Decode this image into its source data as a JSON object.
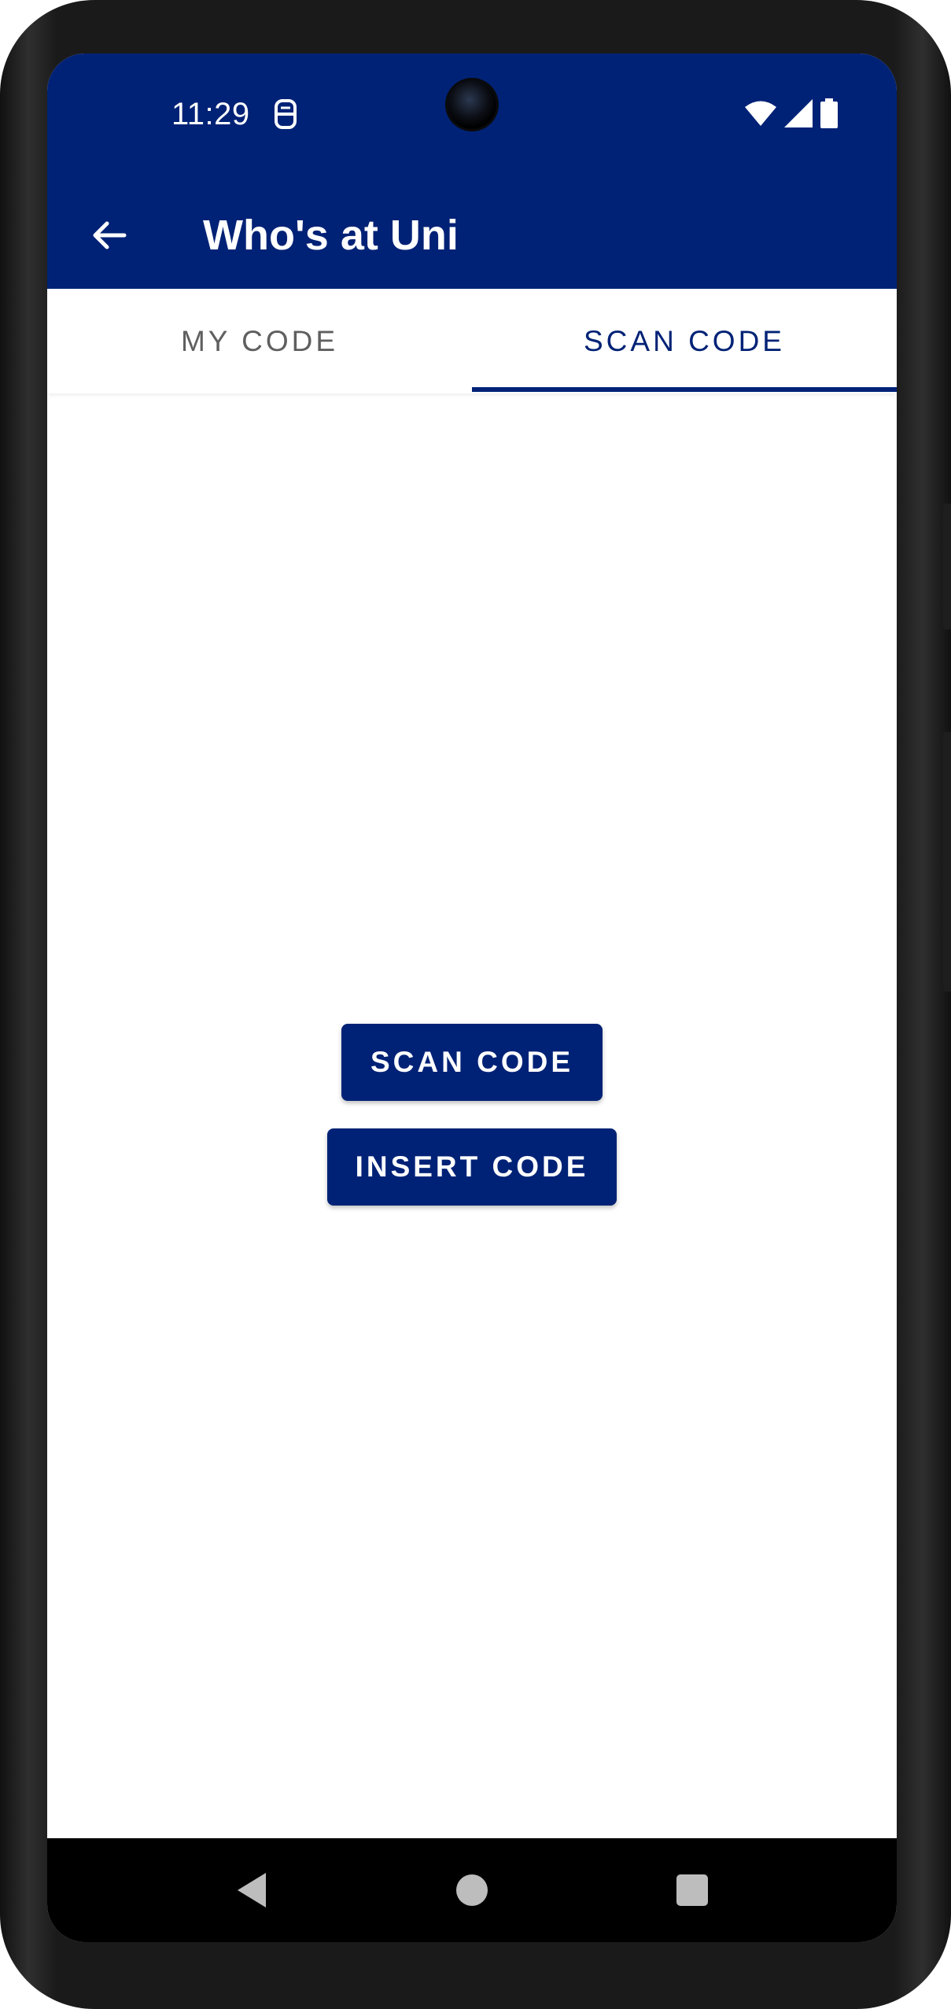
{
  "status_bar": {
    "time": "11:29",
    "notification_icon": "sim-icon",
    "icons": [
      "wifi-icon",
      "signal-icon",
      "battery-icon"
    ]
  },
  "toolbar": {
    "title": "Who's at Uni",
    "back_icon": "arrow-back-icon"
  },
  "tabs": [
    {
      "label": "MY CODE",
      "selected": false
    },
    {
      "label": "SCAN CODE",
      "selected": true
    }
  ],
  "main": {
    "scan_button_label": "SCAN CODE",
    "insert_button_label": "INSERT CODE"
  },
  "nav_bar": {
    "buttons": [
      "back-triangle-icon",
      "home-circle-icon",
      "recents-square-icon"
    ]
  },
  "colors": {
    "primary": "#002276",
    "tab_unselected": "#5f5f5f",
    "background": "#ffffff"
  }
}
